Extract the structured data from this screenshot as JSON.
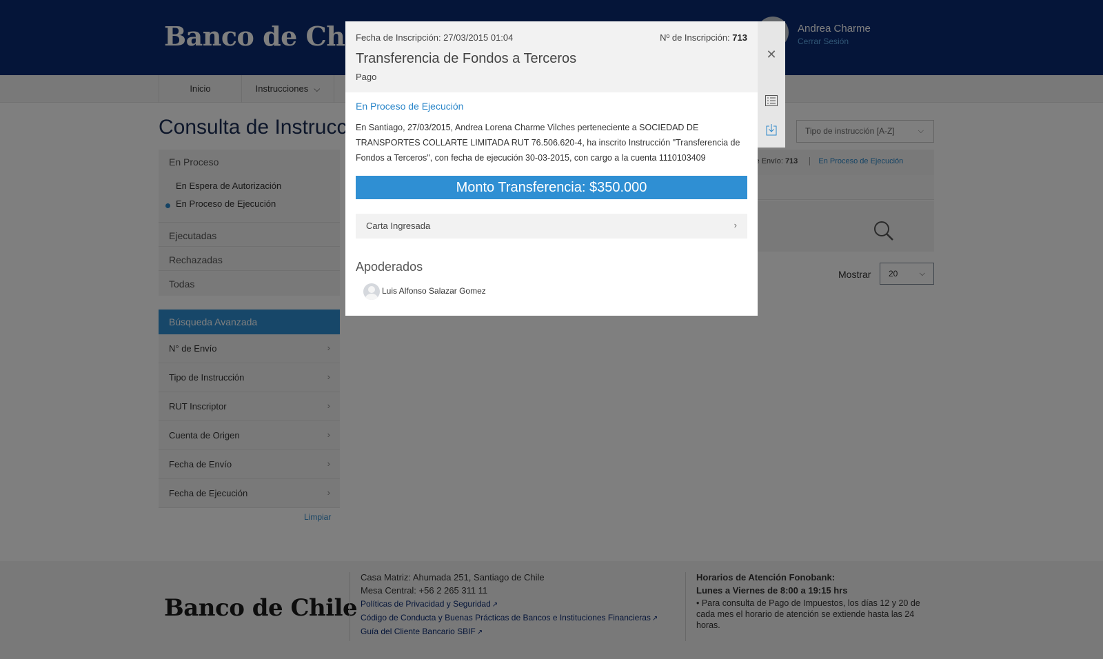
{
  "brand": {
    "name": "Banco de Chile"
  },
  "user": {
    "name": "Andrea Charme",
    "logout": "Cerrar Sesión"
  },
  "nav": {
    "inicio": "Inicio",
    "instrucciones": "Instrucciones"
  },
  "page": {
    "title": "Consulta de Instrucc",
    "sort_placeholder": "Tipo de instrucción [A-Z]"
  },
  "sidebar": {
    "en_proceso": "En Proceso",
    "sub_espera": "En Espera de Autorización",
    "sub_ejecucion": "En Proceso de Ejecución",
    "ejecutadas": "Ejecutadas",
    "rechazadas": "Rechazadas",
    "todas": "Todas"
  },
  "advanced": {
    "title": "Búsqueda Avanzada",
    "items": [
      "N° de Envío",
      "Tipo de Instrucción",
      "RUT Inscriptor",
      "Cuenta de Origen",
      "Fecha de Envío",
      "Fecha de Ejecución"
    ],
    "clear": "Limpiar"
  },
  "list": {
    "envio_label": "N° de Envío:",
    "envio_value": "713",
    "status": "En Proceso de Ejecución",
    "mostrar_label": "Mostrar",
    "mostrar_value": "20"
  },
  "modal": {
    "date": "Fecha de Inscripción: 27/03/2015 01:04",
    "num_label": "Nº de Inscripción:",
    "num_value": "713",
    "title": "Transferencia de Fondos a Terceros",
    "subtitle": "Pago",
    "status": "En Proceso de Ejecución",
    "description": "En Santiago, 27/03/2015, Andrea Lorena Charme Vilches perteneciente a SOCIEDAD DE TRANSPORTES COLLARTE LIMITADA RUT 76.506.620-4, ha inscrito Instrucción \"Transferencia de Fondos a Terceros\", con fecha de ejecución 30-03-2015, con cargo a la cuenta 1110103409",
    "amount": "Monto Transferencia: $350.000",
    "carta": "Carta Ingresada",
    "apoderados_title": "Apoderados",
    "apoderado": "Luis Alfonso Salazar Gomez"
  },
  "footer": {
    "address": "Casa Matriz: Ahumada 251, Santiago de Chile",
    "phone": "Mesa Central: +56 2 265 311 11",
    "link1": "Políticas de Privacidad y Seguridad",
    "link2": "Código de Conducta y Buenas Prácticas de Bancos e Instituciones Financieras",
    "link3": "Guía del Cliente Bancario SBIF",
    "hours_title": "Horarios de Atención Fonobank:",
    "hours_days": "Lunes a Viernes de 8:00 a 19:15 hrs",
    "hours_note": "• Para consulta de Pago de Impuestos, los días 12 y 20 de cada mes el horario de atención se extiende hasta las 24 horas."
  },
  "colors": {
    "brand_navy": "#0b2b73",
    "accent_blue": "#2f8fd3",
    "link_blue": "#2a86c9"
  }
}
